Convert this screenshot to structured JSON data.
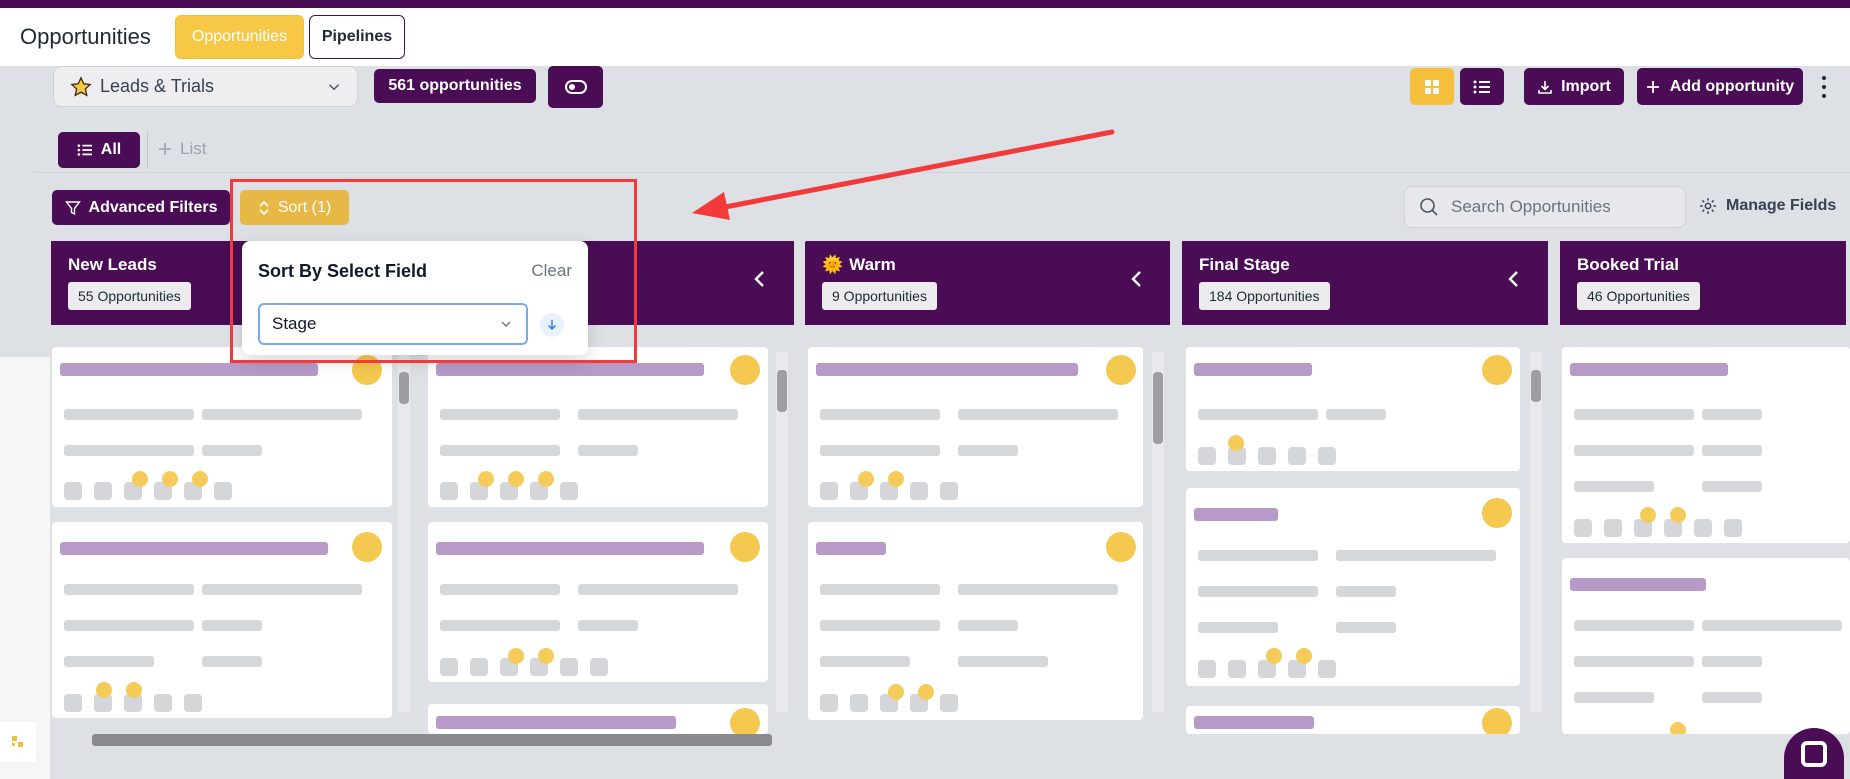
{
  "header": {
    "title": "Opportunities",
    "tabs": [
      {
        "label": "Opportunities",
        "active": true
      },
      {
        "label": "Pipelines",
        "active": false
      }
    ]
  },
  "toolbar": {
    "pipeline": "Leads & Trials",
    "count_label": "561 opportunities",
    "import_label": "Import",
    "add_label": "Add opportunity"
  },
  "views": {
    "all_label": "All",
    "add_list_label": "List"
  },
  "filters": {
    "advanced_label": "Advanced Filters",
    "sort_label": "Sort (1)",
    "search_placeholder": "Search Opportunities",
    "manage_fields_label": "Manage Fields"
  },
  "sort_popover": {
    "title": "Sort By Select Field",
    "clear_label": "Clear",
    "selected_field": "Stage"
  },
  "columns": [
    {
      "title": "New Leads",
      "count": "55 Opportunities",
      "emoji": ""
    },
    {
      "title": "",
      "count": "",
      "emoji": ""
    },
    {
      "title": "Warm",
      "count": "9 Opportunities",
      "emoji": "🌞"
    },
    {
      "title": "Final Stage",
      "count": "184 Opportunities",
      "emoji": ""
    },
    {
      "title": "Booked Trial",
      "count": "46 Opportunities",
      "emoji": ""
    }
  ],
  "colors": {
    "brand": "#4a0d55",
    "accent": "#f3bf3c",
    "annotation": "#f23a3a"
  }
}
